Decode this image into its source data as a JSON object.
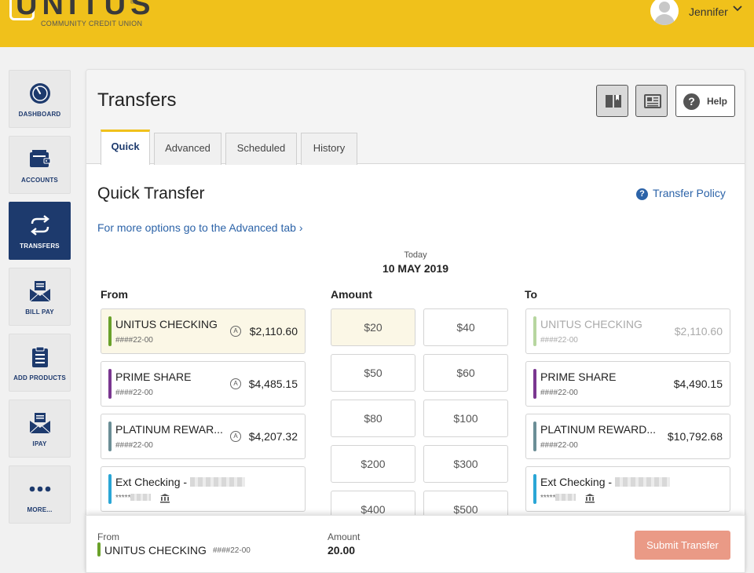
{
  "header": {
    "logo": "UNITUS",
    "logo_sub": "COMMUNITY CREDIT UNION",
    "user_name": "Jennifer"
  },
  "sidebar": {
    "items": [
      {
        "label": "DASHBOARD",
        "icon": "gauge-icon"
      },
      {
        "label": "ACCOUNTS",
        "icon": "wallet-icon"
      },
      {
        "label": "TRANSFERS",
        "icon": "transfer-arrows-icon",
        "active": true
      },
      {
        "label": "BILL PAY",
        "icon": "envelope-icon"
      },
      {
        "label": "ADD PRODUCTS",
        "icon": "clipboard-icon"
      },
      {
        "label": "IPAY",
        "icon": "envelope-icon"
      },
      {
        "label": "MORE...",
        "icon": "more-dots-icon"
      }
    ]
  },
  "page": {
    "title": "Transfers",
    "help_label": "Help",
    "tabs": [
      "Quick",
      "Advanced",
      "Scheduled",
      "History"
    ],
    "active_tab": "Quick"
  },
  "quick": {
    "title": "Quick Transfer",
    "policy_link": "Transfer Policy",
    "advanced_link": "For more options go to the Advanced tab ›",
    "date_label": "Today",
    "date_value": "10 MAY 2019",
    "from_header": "From",
    "amount_header": "Amount",
    "to_header": "To"
  },
  "from_accounts": [
    {
      "name": "UNITUS CHECKING",
      "number": "####22-00",
      "balance": "$2,110.60",
      "flag": "A",
      "color": "#6aa12a"
    },
    {
      "name": "PRIME SHARE",
      "number": "####22-00",
      "balance": "$4,485.15",
      "flag": "A",
      "color": "#7a3790"
    },
    {
      "name": "PLATINUM REWAR...",
      "number": "####22-00",
      "balance": "$4,207.32",
      "flag": "A",
      "color": "#6b8e96"
    },
    {
      "name": "Ext Checking -",
      "number": "*****",
      "color": "#2aa6d6"
    }
  ],
  "amounts": [
    "$20",
    "$40",
    "$50",
    "$60",
    "$80",
    "$100",
    "$200",
    "$300",
    "$400",
    "$500"
  ],
  "to_accounts": [
    {
      "name": "UNITUS CHECKING",
      "number": "####22-00",
      "balance": "$2,110.60",
      "color": "#b7d6a0"
    },
    {
      "name": "PRIME SHARE",
      "number": "####22-00",
      "balance": "$4,490.15",
      "color": "#7a3790"
    },
    {
      "name": "PLATINUM REWARD...",
      "number": "####22-00",
      "balance": "$10,792.68",
      "color": "#6b8e96"
    },
    {
      "name": "Ext Checking -",
      "number": "*****",
      "color": "#2aa6d6"
    }
  ],
  "footer": {
    "from_label": "From",
    "from_value": "UNITUS CHECKING",
    "from_number": "####22-00",
    "amount_label": "Amount",
    "amount_value": "20.00",
    "submit_label": "Submit Transfer"
  }
}
